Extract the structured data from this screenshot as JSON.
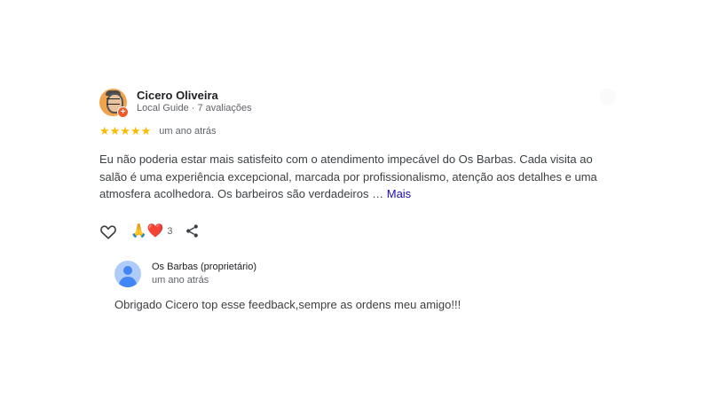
{
  "review": {
    "author": {
      "name": "Cicero Oliveira",
      "meta": "Local Guide · 7 avaliações",
      "badge": "+"
    },
    "rating": {
      "stars_text": "★★★★★",
      "value": 5,
      "out_of": 5,
      "time": "um ano atrás"
    },
    "text": "Eu não poderia estar mais satisfeito com o atendimento impecável do Os Barbas. Cada visita ao salão é uma experiência excepcional, marcada por profissionalismo, atenção aos detalhes e uma atmosfera acolhedora. Os barbeiros são verdadeiros …",
    "more_label": "Mais",
    "actions": {
      "like_icon": "heart-outline-icon",
      "reaction_emoji": "🙏❤️",
      "reaction_count": "3",
      "share_icon": "share-icon"
    },
    "colors": {
      "star": "#fbbc04",
      "link": "#1a0dab",
      "secondary_text": "#5f6368"
    }
  },
  "reply": {
    "owner_name": "Os Barbas (proprietário)",
    "time": "um ano atrás",
    "text": "Obrigado Cicero top esse feedback,sempre as ordens meu amigo!!!"
  }
}
